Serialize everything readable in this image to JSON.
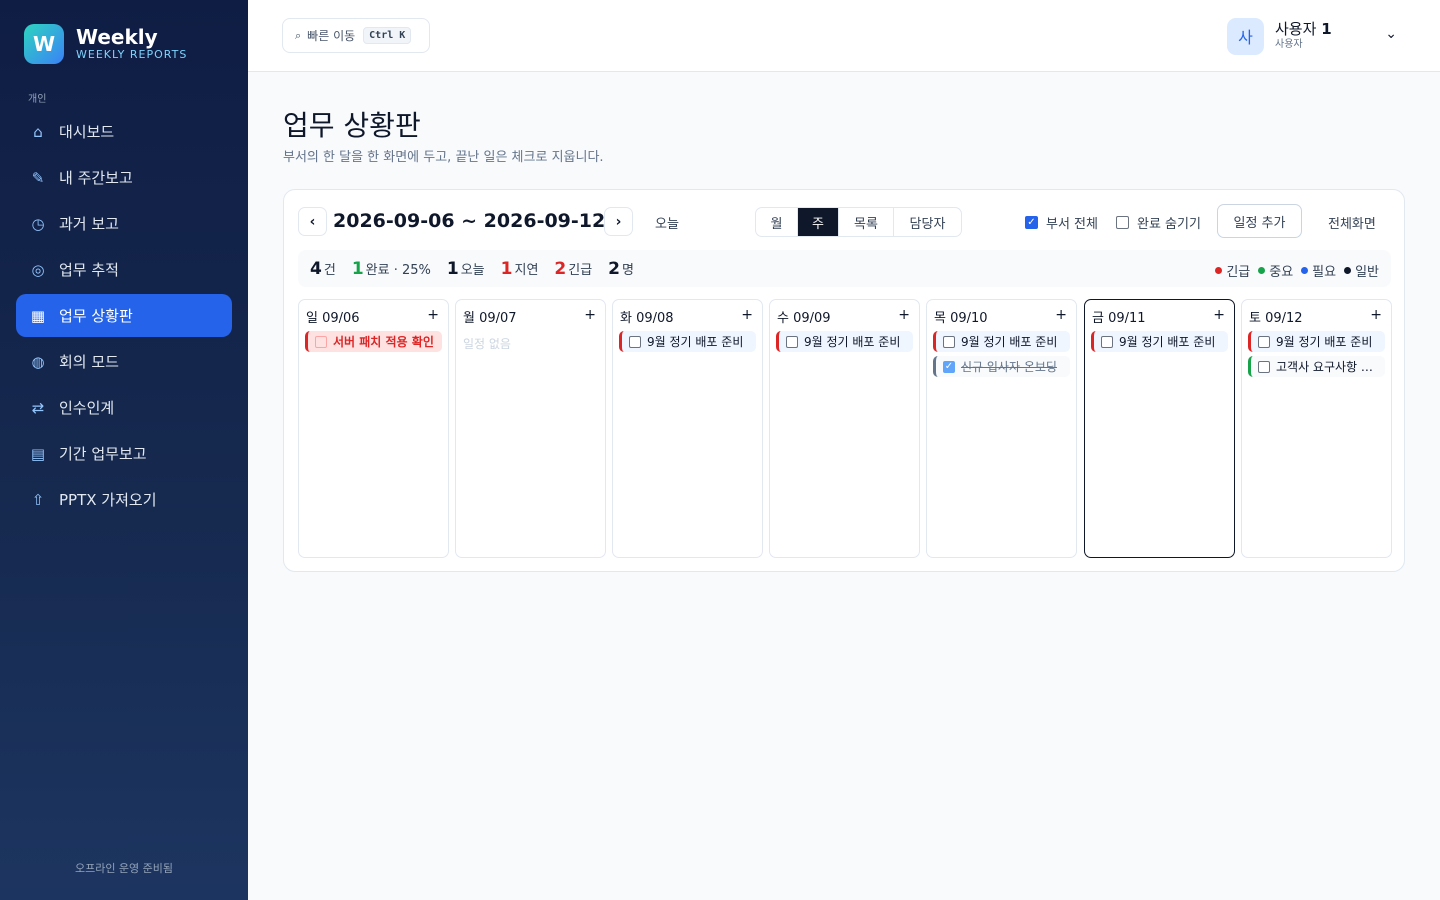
{
  "brand": {
    "logo_letter": "W",
    "name": "Weekly",
    "sub": "WEEKLY REPORTS"
  },
  "sidebar": {
    "section_label": "개인",
    "items": [
      {
        "icon": "home-icon",
        "glyph": "⌂",
        "label": "대시보드"
      },
      {
        "icon": "pencil-icon",
        "glyph": "✎",
        "label": "내 주간보고"
      },
      {
        "icon": "clock-icon",
        "glyph": "◷",
        "label": "과거 보고"
      },
      {
        "icon": "target-icon",
        "glyph": "◎",
        "label": "업무 추적"
      },
      {
        "icon": "grid-icon",
        "glyph": "▦",
        "label": "업무 상황판",
        "active": true
      },
      {
        "icon": "globe-icon",
        "glyph": "◍",
        "label": "회의 모드"
      },
      {
        "icon": "transfer-icon",
        "glyph": "⇄",
        "label": "인수인계"
      },
      {
        "icon": "document-icon",
        "glyph": "▤",
        "label": "기간 업무보고"
      },
      {
        "icon": "upload-icon",
        "glyph": "⇧",
        "label": "PPTX 가져오기"
      }
    ],
    "footer": "오프라인 운영 준비됨"
  },
  "topbar": {
    "quick_jump": {
      "label": "빠른 이동",
      "shortcut": "Ctrl K"
    },
    "user": {
      "avatar_letter": "사",
      "name": "사용자",
      "number": "1",
      "role": "사용자"
    }
  },
  "page": {
    "title": "업무 상황판",
    "subtitle": "부서의 한 달을 한 화면에 두고, 끝난 일은 체크로 지웁니다."
  },
  "calendar": {
    "range": "2026-09-06 ~ 2026-09-12",
    "prev": "‹",
    "next": "›",
    "today_label": "오늘",
    "views": [
      "월",
      "주",
      "목록",
      "담당자"
    ],
    "active_view": "주",
    "toggles": {
      "dept_all": "부서 전체",
      "hide_done": "완료 숨기기",
      "dept_all_checked": true,
      "hide_done_checked": false
    },
    "add_label": "일정 추가",
    "fullscreen_label": "전체화면",
    "stats": {
      "total": {
        "num": "4",
        "label": "건"
      },
      "done": {
        "num": "1",
        "label": "완료 · 25%"
      },
      "today": {
        "num": "1",
        "label": "오늘"
      },
      "overdue": {
        "num": "1",
        "label": "지연"
      },
      "urgent": {
        "num": "2",
        "label": "긴급"
      },
      "people": {
        "num": "2",
        "label": "명"
      }
    },
    "legend": [
      {
        "label": "긴급",
        "color": "#dc2626"
      },
      {
        "label": "중요",
        "color": "#16a34a"
      },
      {
        "label": "필요",
        "color": "#2563eb"
      },
      {
        "label": "일반",
        "color": "#0f172a"
      }
    ],
    "days": [
      {
        "weekday": "일",
        "date": "09/06",
        "events": [
          {
            "title": "서버 패치 적용 확인",
            "style": "red",
            "done": false
          }
        ]
      },
      {
        "weekday": "월",
        "date": "09/07",
        "events": [],
        "empty": "일정 없음"
      },
      {
        "weekday": "화",
        "date": "09/08",
        "events": [
          {
            "title": "9월 정기 배포 준비",
            "style": "blue-red",
            "done": false
          }
        ]
      },
      {
        "weekday": "수",
        "date": "09/09",
        "events": [
          {
            "title": "9월 정기 배포 준비",
            "style": "blue-red",
            "done": false
          }
        ]
      },
      {
        "weekday": "목",
        "date": "09/10",
        "events": [
          {
            "title": "9월 정기 배포 준비",
            "style": "blue-red",
            "done": false
          },
          {
            "title": "신규 입사자 온보딩",
            "style": "gray",
            "done": true
          }
        ]
      },
      {
        "weekday": "금",
        "date": "09/11",
        "today": true,
        "events": [
          {
            "title": "9월 정기 배포 준비",
            "style": "blue-red",
            "done": false
          }
        ]
      },
      {
        "weekday": "토",
        "date": "09/12",
        "events": [
          {
            "title": "9월 정기 배포 준비",
            "style": "blue-red",
            "done": false
          },
          {
            "title": "고객사 요구사항 검토",
            "style": "green",
            "done": false
          }
        ]
      }
    ],
    "add_day_glyph": "+"
  }
}
